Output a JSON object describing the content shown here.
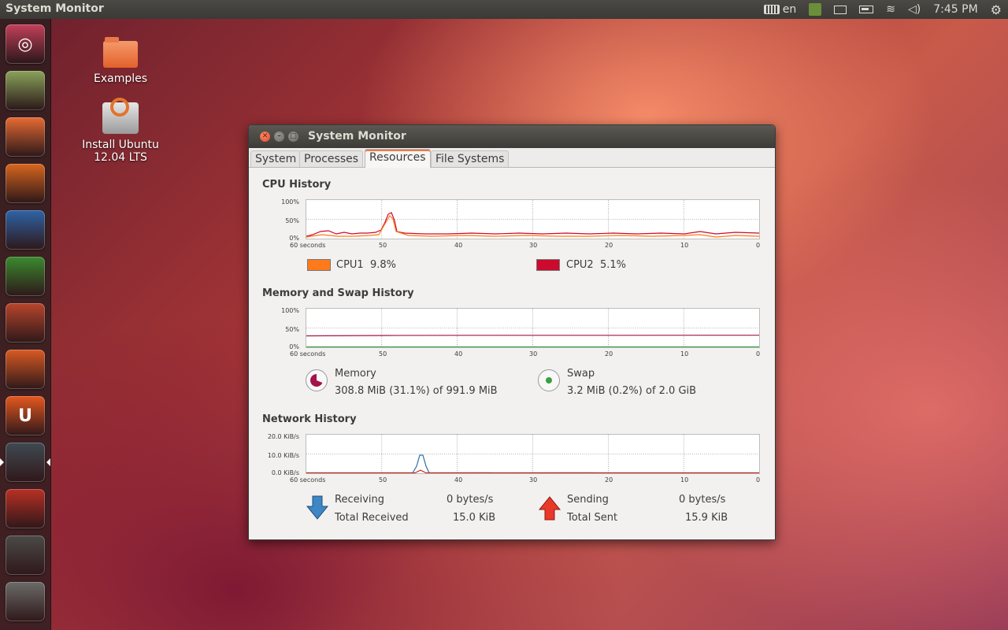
{
  "top_panel": {
    "app_title": "System Monitor",
    "keyboard_layout": "en",
    "clock": "7:45 PM"
  },
  "launcher": {
    "items": [
      {
        "name": "dash-home-icon",
        "glyph": "◎",
        "color": "#c3405a"
      },
      {
        "name": "ubuntu-installer-icon",
        "glyph": "",
        "color": "#8aa35a"
      },
      {
        "name": "home-folder-icon",
        "glyph": "",
        "color": "#e66b34"
      },
      {
        "name": "firefox-icon",
        "glyph": "",
        "color": "#d8661e"
      },
      {
        "name": "libreoffice-writer-icon",
        "glyph": "",
        "color": "#2f63a6"
      },
      {
        "name": "libreoffice-calc-icon",
        "glyph": "",
        "color": "#3b8a2f"
      },
      {
        "name": "libreoffice-impress-icon",
        "glyph": "",
        "color": "#b8452c"
      },
      {
        "name": "software-center-icon",
        "glyph": "",
        "color": "#d95a23"
      },
      {
        "name": "ubuntu-one-icon",
        "glyph": "U",
        "color": "#e5581f"
      },
      {
        "name": "system-monitor-icon",
        "glyph": "",
        "color": "#3f4a52"
      },
      {
        "name": "system-settings-icon",
        "glyph": "",
        "color": "#b83024"
      },
      {
        "name": "workspace-switcher-icon",
        "glyph": "",
        "color": "#4a4b48"
      },
      {
        "name": "trash-icon",
        "glyph": "",
        "color": "#6a6b68"
      }
    ]
  },
  "desktop": {
    "icons": [
      {
        "label": "Examples"
      },
      {
        "label": "Install Ubuntu 12.04 LTS"
      }
    ]
  },
  "window": {
    "title": "System Monitor",
    "tabs": [
      {
        "label": "System"
      },
      {
        "label": "Processes"
      },
      {
        "label": "Resources"
      },
      {
        "label": "File Systems"
      }
    ],
    "active_tab": "Resources",
    "cpu": {
      "title": "CPU History",
      "y_ticks": [
        "100%",
        "50%",
        "0%"
      ],
      "x_ticks": [
        "60 seconds",
        "50",
        "40",
        "30",
        "20",
        "10",
        "0"
      ],
      "cpu1_label": "CPU1",
      "cpu1_value": "9.8%",
      "cpu1_color": "#ff7a1a",
      "cpu2_label": "CPU2",
      "cpu2_value": "5.1%",
      "cpu2_color": "#cc0a2e"
    },
    "memory": {
      "title": "Memory and Swap History",
      "y_ticks": [
        "100%",
        "50%",
        "0%"
      ],
      "x_ticks": [
        "60 seconds",
        "50",
        "40",
        "30",
        "20",
        "10",
        "0"
      ],
      "memory_label": "Memory",
      "memory_value": "308.8 MiB (31.1%) of 991.9 MiB",
      "memory_color": "#a4134a",
      "swap_label": "Swap",
      "swap_value": "3.2 MiB (0.2%) of 2.0 GiB",
      "swap_color": "#3aa040"
    },
    "network": {
      "title": "Network History",
      "y_ticks": [
        "20.0 KiB/s",
        "10.0 KiB/s",
        "0.0 KiB/s"
      ],
      "x_ticks": [
        "60 seconds",
        "50",
        "40",
        "30",
        "20",
        "10",
        "0"
      ],
      "receiving_label": "Receiving",
      "receiving_value": "0 bytes/s",
      "total_received_label": "Total Received",
      "total_received_value": "15.0 KiB",
      "sending_label": "Sending",
      "sending_value": "0 bytes/s",
      "total_sent_label": "Total Sent",
      "total_sent_value": "15.9 KiB",
      "receive_color": "#2d6fa8",
      "send_color": "#c8261a"
    }
  }
}
